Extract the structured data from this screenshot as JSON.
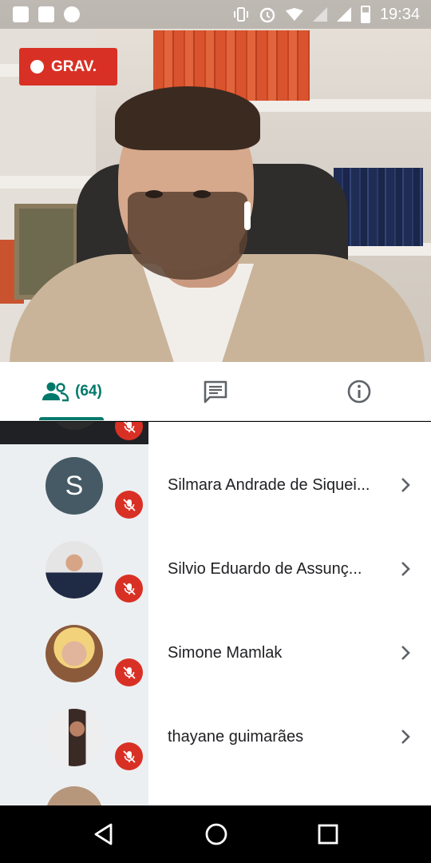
{
  "status_bar": {
    "time": "19:34",
    "left_icons": [
      "screenshot-icon",
      "image-icon",
      "meet-icon"
    ],
    "right_icons": [
      "vibrate-icon",
      "alarm-icon",
      "wifi-icon",
      "signal-icon",
      "battery-icon"
    ]
  },
  "recording": {
    "label": "GRAV."
  },
  "tabs": {
    "people": {
      "count_label": "(64)",
      "icon": "people-icon"
    },
    "chat": {
      "icon": "chat-icon"
    },
    "info": {
      "icon": "info-icon"
    }
  },
  "participants": [
    {
      "name": "Silmara Andrade de Siquei...",
      "avatar_letter": "S",
      "muted": true
    },
    {
      "name": "Silvio Eduardo de Assunç...",
      "avatar_letter": "",
      "muted": true
    },
    {
      "name": "Simone Mamlak",
      "avatar_letter": "",
      "muted": true
    },
    {
      "name": "thayane guimarães",
      "avatar_letter": "",
      "muted": true
    }
  ],
  "colors": {
    "accent": "#00796b",
    "record_red": "#d93025",
    "avatar_gray": "#455a64"
  }
}
